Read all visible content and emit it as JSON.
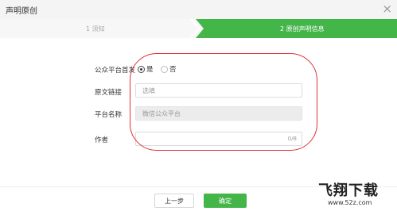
{
  "dialog": {
    "title": "声明原创",
    "close_glyph": "×"
  },
  "steps": [
    {
      "label": "1 须知",
      "active": false
    },
    {
      "label": "2 原创声明信息",
      "active": true
    }
  ],
  "colors": {
    "accent": "#44b549",
    "highlight": "#e0303a"
  },
  "form": {
    "first_publish": {
      "label": "公众平台首发",
      "options": [
        {
          "label": "是",
          "checked": true
        },
        {
          "label": "否",
          "checked": false
        }
      ]
    },
    "source_link": {
      "label": "原文链接",
      "placeholder": "选填"
    },
    "platform_name": {
      "label": "平台名称",
      "value": "微信公众平台"
    },
    "author": {
      "label": "作者",
      "value": "",
      "counter": "0/8"
    }
  },
  "buttons": {
    "prev": "上一步",
    "confirm": "确定"
  },
  "watermark": {
    "logo_text": "飞翔下载",
    "url": "www.52z.com"
  }
}
